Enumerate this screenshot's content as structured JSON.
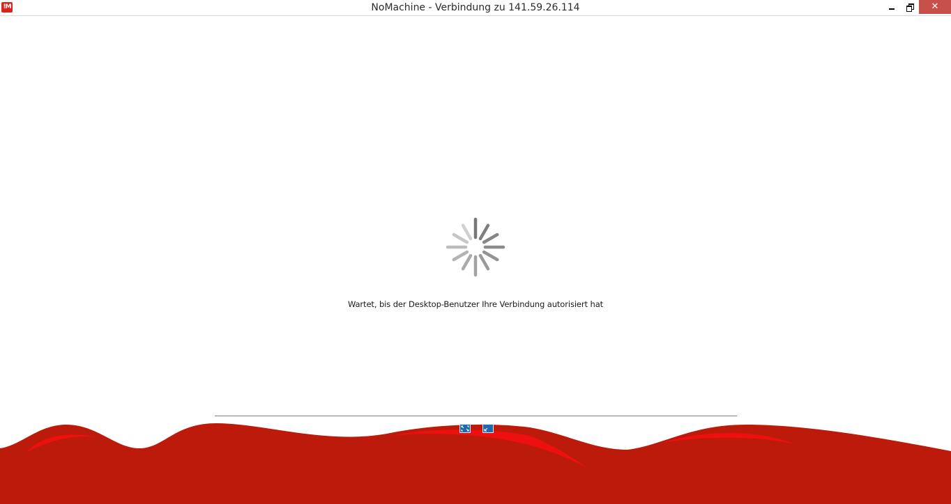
{
  "window": {
    "title": "NoMachine - Verbindung zu 141.59.26.114",
    "logo_text": "!M",
    "minimize_label": "",
    "close_label": "✕"
  },
  "main": {
    "status_text": "Wartet, bis der Desktop-Benutzer Ihre Verbindung autorisiert hat",
    "spinner_icon": "loading-spinner-icon"
  },
  "controls": {
    "fullscreen_icon": "fullscreen-icon",
    "resize_icon": "resize-icon"
  },
  "colors": {
    "brand_red": "#bc1a0a",
    "brand_red_highlight": "#ee1010",
    "control_blue": "#1f6aa8",
    "close_button": "#c7504b"
  }
}
